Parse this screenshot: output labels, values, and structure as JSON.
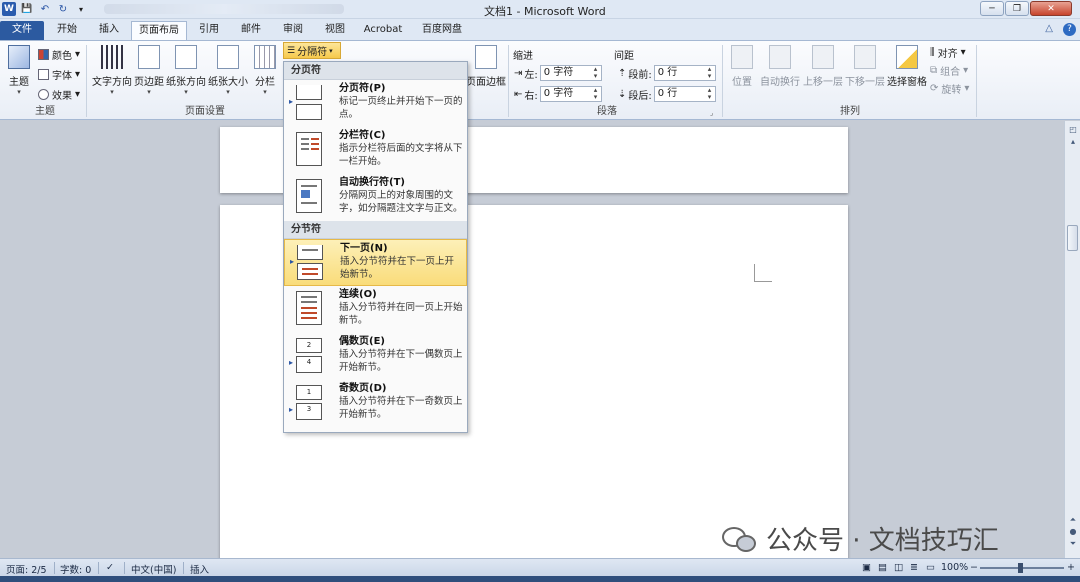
{
  "window": {
    "title": "文档1 - Microsoft Word",
    "minimize": "─",
    "restore": "❐",
    "close": "✕"
  },
  "qat": {
    "logo": "W",
    "save": "💾",
    "undo": "↶",
    "redo": "↻",
    "more": "▾"
  },
  "tabs": {
    "file": "文件",
    "items": [
      "开始",
      "插入",
      "页面布局",
      "引用",
      "邮件",
      "审阅",
      "视图",
      "Acrobat",
      "百度网盘"
    ],
    "active_index": 2,
    "help": "?",
    "collapse": "△"
  },
  "ribbon": {
    "themes": {
      "theme_label": "主题",
      "colors_label": "颜色",
      "fonts_label": "字体",
      "effects_label": "效果",
      "group_label": "主题"
    },
    "page_setup": {
      "text_direction": "文字方向",
      "margins": "页边距",
      "orientation": "纸张方向",
      "size": "纸张大小",
      "columns": "分栏",
      "breaks_button": "分隔符",
      "group_label": "页面设置"
    },
    "page_background": {
      "page_borders": "页面边框"
    },
    "paragraph": {
      "indent_label": "缩进",
      "spacing_label": "间距",
      "left_label": "左:",
      "left_value": "0 字符",
      "right_label": "右:",
      "right_value": "0 字符",
      "before_label": "段前:",
      "before_value": "0 行",
      "after_label": "段后:",
      "after_value": "0 行",
      "group_label": "段落"
    },
    "arrange": {
      "position": "位置",
      "wrap_text": "自动换行",
      "bring_forward": "上移一层",
      "send_backward": "下移一层",
      "selection_pane": "选择窗格",
      "align": "对齐",
      "group": "组合",
      "rotate": "旋转",
      "group_label": "排列"
    }
  },
  "breaks_menu": {
    "page_breaks_header": "分页符",
    "section_breaks_header": "分节符",
    "items": [
      {
        "title": "分页符(P)",
        "desc": "标记一页终止并开始下一页的点。"
      },
      {
        "title": "分栏符(C)",
        "desc": "指示分栏符后面的文字将从下一栏开始。"
      },
      {
        "title": "自动换行符(T)",
        "desc": "分隔网页上的对象周围的文字，如分隔题注文字与正文。"
      },
      {
        "title": "下一页(N)",
        "desc": "插入分节符并在下一页上开始新节。"
      },
      {
        "title": "连续(O)",
        "desc": "插入分节符并在同一页上开始新节。"
      },
      {
        "title": "偶数页(E)",
        "desc": "插入分节符并在下一偶数页上开始新节。"
      },
      {
        "title": "奇数页(D)",
        "desc": "插入分节符并在下一奇数页上开始新节。"
      }
    ],
    "highlighted_index": 3,
    "even_icon_num": "2",
    "even_icon_num2": "4",
    "odd_icon_num": "1",
    "odd_icon_num2": "3"
  },
  "status_bar": {
    "page": "页面: 2/5",
    "words": "字数: 0",
    "language": "中文(中国)",
    "mode": "插入",
    "zoom": "100%",
    "zoom_out": "−",
    "zoom_in": "+"
  },
  "watermark": {
    "text": "公众号 · 文档技巧汇"
  },
  "colors": {
    "accent": "#2c5aa0",
    "highlight": "#f9dc7a"
  }
}
